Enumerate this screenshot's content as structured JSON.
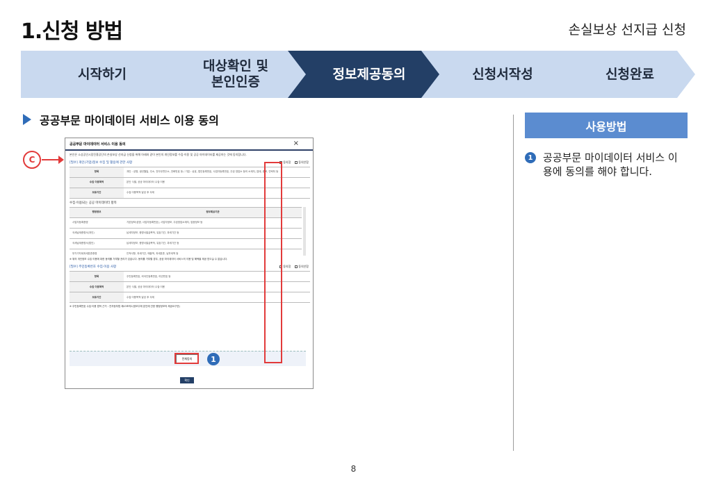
{
  "page": {
    "title": "1.신청 방법",
    "subtitle": "손실보상 선지급 신청",
    "number": "8"
  },
  "steps": [
    {
      "label": "시작하기",
      "active": false
    },
    {
      "label": "대상확인 및 본인인증",
      "active": false
    },
    {
      "label": "정보제공동의",
      "active": true
    },
    {
      "label": "신청서작성",
      "active": false
    },
    {
      "label": "신청완료",
      "active": false
    }
  ],
  "section": {
    "heading": "공공부문 마이데이터 서비스 이용 동의"
  },
  "callout_c": "C",
  "dialog": {
    "title": "공공부문 마이데이터 서비스 이용 동의",
    "close": "×",
    "intro": "본인은 소상공인시장진흥공단의 손실보상 선지급 신청을 위해 아래와 같이 본인의 개인정보를 수집·이용 및 공공 마이데이터를 제공하는 것에 동의합니다.",
    "group1": {
      "title": "[필수] 개인(기업)정보 수집 및 활용에 관한 사항",
      "agree": "동의함",
      "disagree": "동의안함",
      "rows": [
        {
          "k": "항목",
          "v": "개인 : 성명, 생년월일, 주소, 전자우편주소, 전화번호 등 / 기업 : 상호, 법인등록번호, 사업자등록번호, 주된 영업소 등의 소재지, 업태, 종목, 연락처 등"
        },
        {
          "k": "수집 이용목적",
          "v": "본인 식별, 공공 마이데이터 수집·이용"
        },
        {
          "k": "보유기간",
          "v": "수집·이용목적 달성 후 삭제"
        }
      ]
    },
    "mydata_label": "수집·이용되는 공공 마이데이터 항목",
    "mydata_header": [
      "행정정보",
      "정보제공기관"
    ],
    "mydata_rows": [
      {
        "k": "사업자등록증명",
        "v": "기본정보(성명, 사업자등록번호), 사업자정보, 주된영업소재지, 업종정보 등"
      },
      {
        "k": "국세납세증명서(개인)",
        "v": "납세자정보, 증명서발급목적, 유효기간, 과세기간 등"
      },
      {
        "k": "국세납세증명서(법인)",
        "v": "납세자정보, 증명서발급목적, 유효기간, 과세기간 등"
      },
      {
        "k": "부가가치세과세표준증명",
        "v": "인적사항, 과세기간, 매출액, 과세표준, 납부세액 등"
      }
    ],
    "notice": "※ 위의 개인정보 수집 이용에 대한 동의를 거부할 권리가 있습니다. 동의를 거부할 경우, 공공 마이데이터 서비스의 이용 및 혜택을 제공 받으실 수 없습니다.",
    "group2": {
      "title": "[필수] 주민등록번호 수집·이용 사항",
      "agree": "동의함",
      "disagree": "동의안함",
      "rows": [
        {
          "k": "항목",
          "v": "주민등록번호, 외국인등록번호, 여권번호 등"
        },
        {
          "k": "수집 이용목적",
          "v": "본인 식별, 공공 마이데이터 수집·이용"
        },
        {
          "k": "보유기간",
          "v": "수집·이용목적 달성 후 삭제"
        }
      ]
    },
    "law_note": "※ 주민등록번호 수집·이용 법적 근거 : 전자정부법 제43조의2(정보주체 본인에 관한 행정정보의 제공요구권)",
    "agree_all": "전체동의",
    "confirm": "확인"
  },
  "badge_num": "1",
  "right": {
    "usage_title": "사용방법",
    "item_num": "1",
    "item_text": "공공부문 마이데이터 서비스 이용에 동의를 해야 합니다."
  }
}
